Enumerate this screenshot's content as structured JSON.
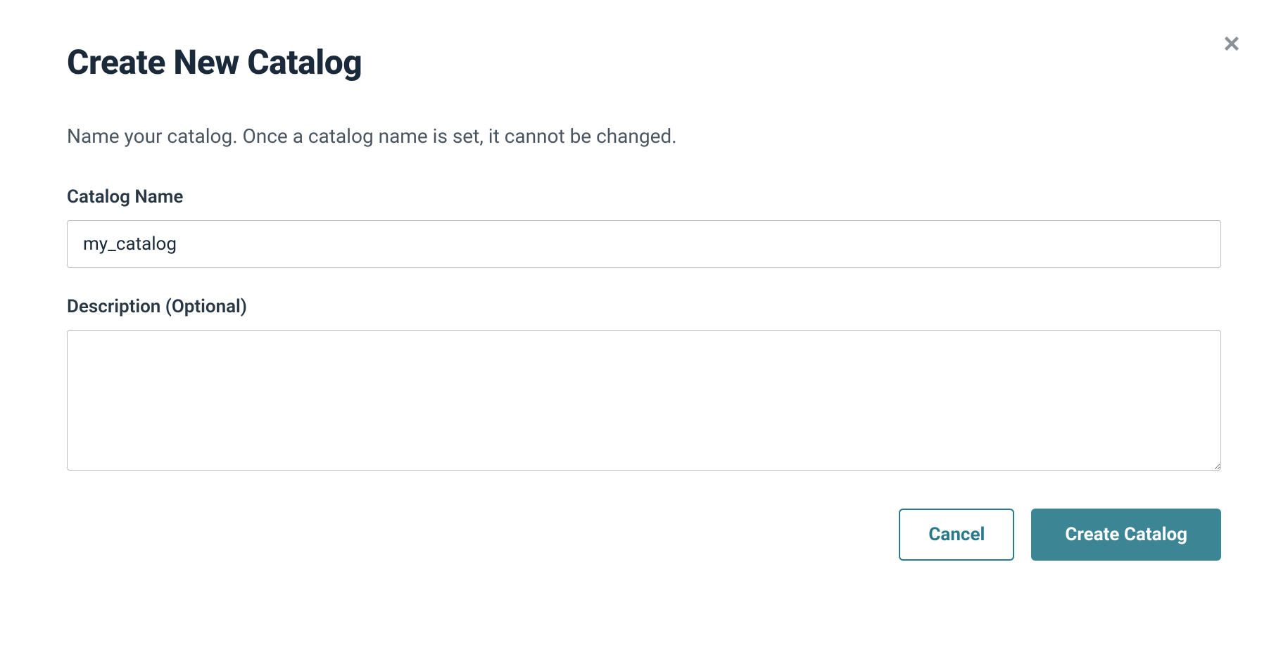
{
  "dialog": {
    "title": "Create New Catalog",
    "subtitle": "Name your catalog. Once a catalog name is set, it cannot be changed.",
    "close_icon": "close"
  },
  "form": {
    "catalog_name": {
      "label": "Catalog Name",
      "value": "my_catalog",
      "placeholder": ""
    },
    "description": {
      "label": "Description (Optional)",
      "value": "",
      "placeholder": ""
    }
  },
  "buttons": {
    "cancel_label": "Cancel",
    "create_label": "Create Catalog"
  },
  "colors": {
    "primary": "#3b8594",
    "text_dark": "#1b2a3a",
    "text_muted": "#4a5560",
    "border": "#b8bec4",
    "close_icon": "#8a9199"
  }
}
